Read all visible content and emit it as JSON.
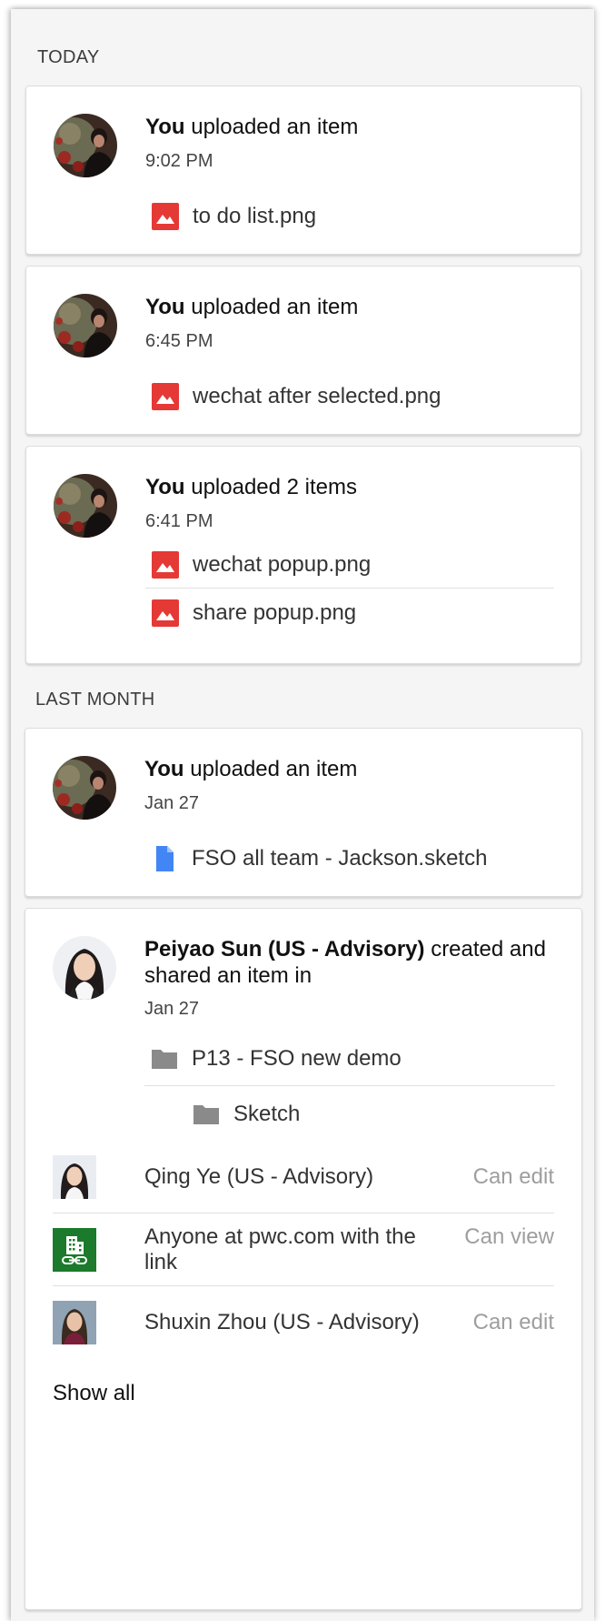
{
  "sections": {
    "today": "TODAY",
    "last_month": "LAST MONTH"
  },
  "cards": [
    {
      "actor": "You",
      "action": "uploaded an item",
      "time": "9:02 PM",
      "files": [
        {
          "name": "to do list.png",
          "icon": "image-file-icon"
        }
      ]
    },
    {
      "actor": "You",
      "action": "uploaded an item",
      "time": "6:45 PM",
      "files": [
        {
          "name": "wechat after selected.png",
          "icon": "image-file-icon"
        }
      ]
    },
    {
      "actor": "You",
      "action": "uploaded 2 items",
      "time": "6:41 PM",
      "files": [
        {
          "name": "wechat popup.png",
          "icon": "image-file-icon"
        },
        {
          "name": "share popup.png",
          "icon": "image-file-icon"
        }
      ]
    },
    {
      "actor": "You",
      "action": "uploaded an item",
      "time": "Jan 27",
      "files": [
        {
          "name": "FSO all team - Jackson.sketch",
          "icon": "document-file-icon"
        }
      ]
    },
    {
      "actor": "Peiyao Sun (US - Advisory)",
      "action": "created and shared an item in",
      "time": "Jan 27",
      "folders": [
        {
          "name": "P13 - FSO new demo",
          "icon": "folder-icon"
        },
        {
          "name": "Sketch",
          "icon": "folder-icon"
        }
      ],
      "permissions": [
        {
          "name": "Qing Ye (US - Advisory)",
          "role": "Can edit"
        },
        {
          "name": "Anyone at pwc.com with the link",
          "role": "Can view"
        },
        {
          "name": "Shuxin Zhou (US - Advisory)",
          "role": "Can edit"
        }
      ],
      "show_all": "Show all"
    }
  ],
  "colors": {
    "image_icon": "#e53935",
    "doc_icon": "#4285f4",
    "folder_icon": "#8a8a8a",
    "domain_link_icon": "#1b7a2b"
  }
}
